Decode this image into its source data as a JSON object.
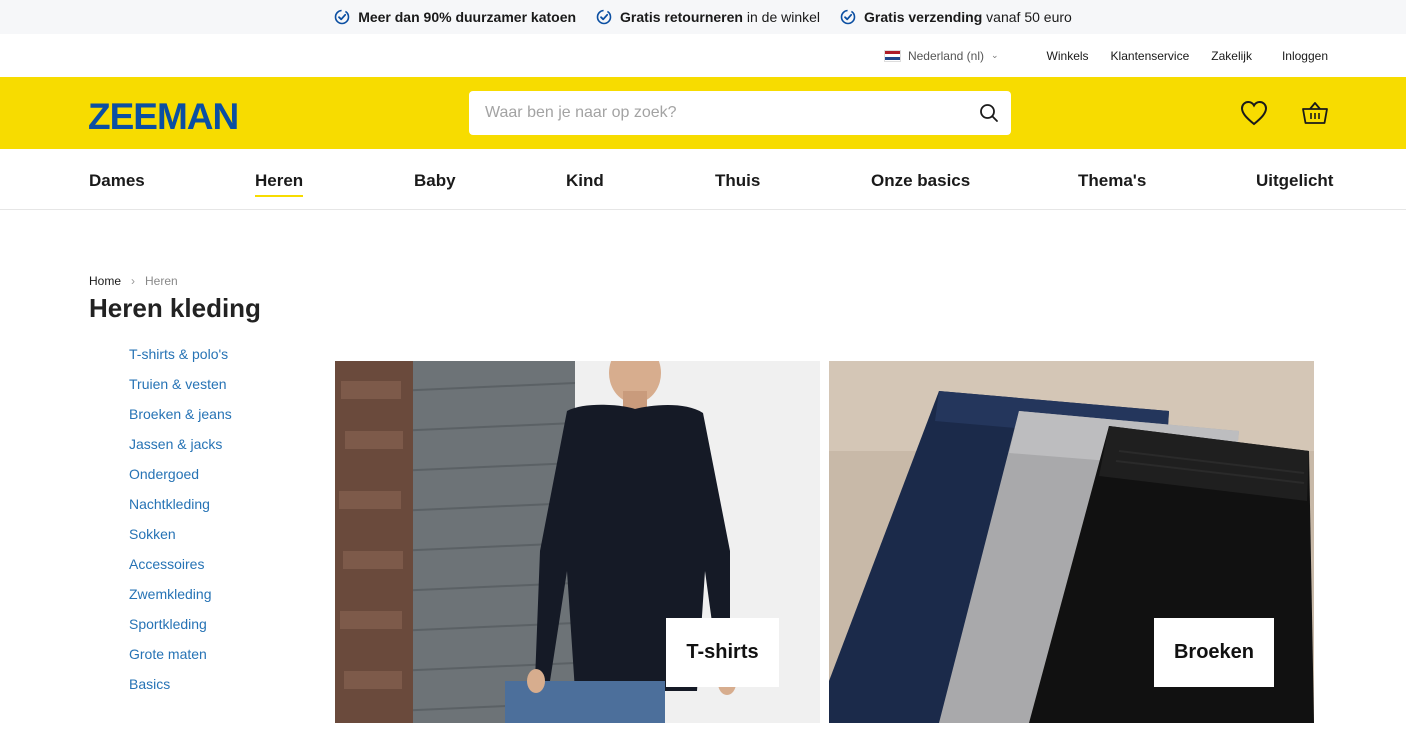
{
  "usps": [
    {
      "bold": "Meer dan 90% duurzamer katoen",
      "rest": "",
      "icon": "check-badge-icon"
    },
    {
      "bold": "Gratis retourneren",
      "rest": " in de winkel",
      "icon": "check-badge-icon"
    },
    {
      "bold": "Gratis verzending",
      "rest": " vanaf 50 euro",
      "icon": "check-badge-icon"
    }
  ],
  "util": {
    "language": "Nederland (nl)",
    "links": [
      "Winkels",
      "Klantenservice",
      "Zakelijk",
      "Inloggen"
    ]
  },
  "header": {
    "logo": "ZEEMAN",
    "search_placeholder": "Waar ben je naar op zoek?"
  },
  "nav": [
    "Dames",
    "Heren",
    "Baby",
    "Kind",
    "Thuis",
    "Onze basics",
    "Thema's",
    "Uitgelicht"
  ],
  "nav_active": "Heren",
  "breadcrumb": {
    "home": "Home",
    "current": "Heren"
  },
  "page_title": "Heren kleding",
  "categories": [
    "T-shirts & polo's",
    "Truien & vesten",
    "Broeken & jeans",
    "Jassen & jacks",
    "Ondergoed",
    "Nachtkleding",
    "Sokken",
    "Accessoires",
    "Zwemkleding",
    "Sportkleding",
    "Grote maten",
    "Basics"
  ],
  "cards": [
    {
      "label": "T-shirts"
    },
    {
      "label": "Broeken"
    }
  ],
  "colors": {
    "brand_yellow": "#f7dc00",
    "brand_blue": "#0b4fa2",
    "link_blue": "#2673b5"
  }
}
